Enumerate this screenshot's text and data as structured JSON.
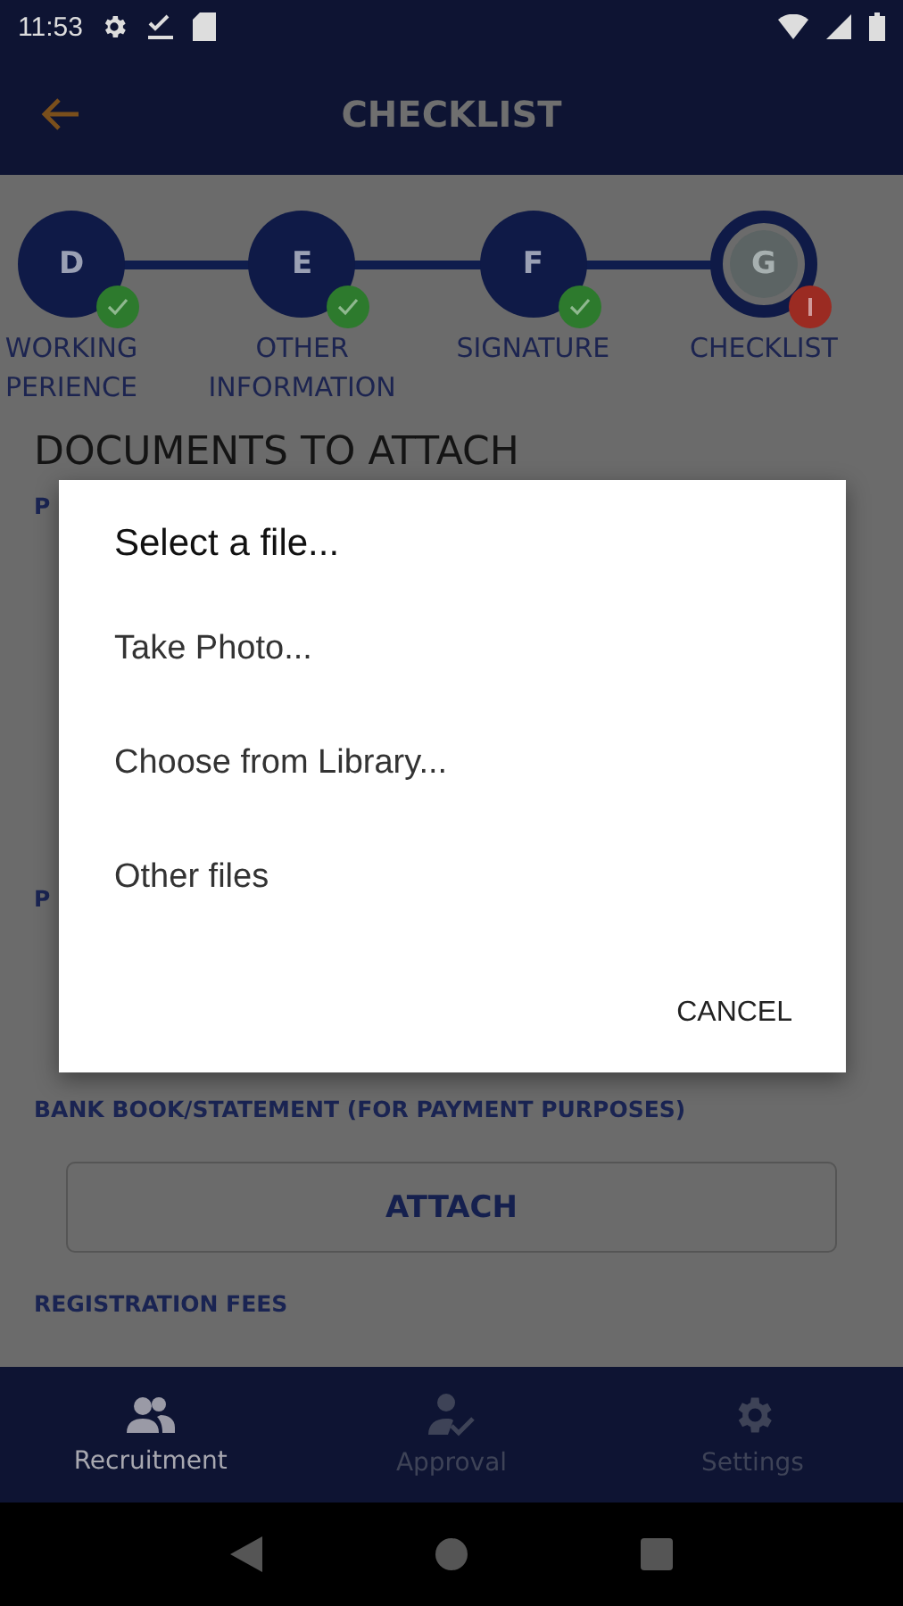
{
  "status_bar": {
    "time": "11:53"
  },
  "app_bar": {
    "title": "CHECKLIST"
  },
  "steps": [
    {
      "letter": "D",
      "label": [
        "WORKING",
        "PERIENCE"
      ],
      "kind": "done",
      "current": false
    },
    {
      "letter": "E",
      "label": [
        "OTHER",
        "INFORMATION"
      ],
      "kind": "done",
      "current": false
    },
    {
      "letter": "F",
      "label": [
        "SIGNATURE"
      ],
      "kind": "done",
      "current": false
    },
    {
      "letter": "G",
      "label": [
        "CHECKLIST"
      ],
      "kind": "error",
      "current": true
    }
  ],
  "section_title": "DOCUMENTS TO ATTACH",
  "documents": [
    {
      "kind": "partial",
      "label": "P"
    },
    {
      "kind": "partial",
      "label": "P"
    },
    {
      "kind": "full",
      "label": "BANK BOOK/STATEMENT (FOR PAYMENT PURPOSES)",
      "button": "ATTACH"
    },
    {
      "kind": "heading",
      "label": "REGISTRATION FEES"
    }
  ],
  "dialog": {
    "title": "Select a file...",
    "options": [
      "Take Photo...",
      "Choose from Library...",
      "Other files"
    ],
    "cancel": "CANCEL"
  },
  "bottom_nav": [
    {
      "label": "Recruitment",
      "kind": "people",
      "selected": true
    },
    {
      "label": "Approval",
      "kind": "person-check",
      "selected": false
    },
    {
      "label": "Settings",
      "kind": "gear",
      "selected": false
    }
  ]
}
